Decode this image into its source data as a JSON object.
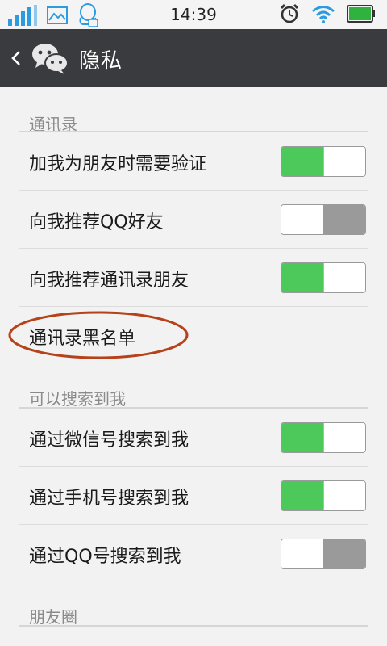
{
  "status_bar": {
    "time": "14:39",
    "icons": [
      "signal-bars-icon",
      "image-icon",
      "qq-icon",
      "alarm-icon",
      "wifi-icon",
      "battery-icon"
    ]
  },
  "header": {
    "title": "隐私",
    "back_icon": "chevron-left-icon",
    "logo": "wechat-logo-icon"
  },
  "sections": [
    {
      "title": "通讯录",
      "items": [
        {
          "label": "加我为朋友时需要验证",
          "toggle": "on"
        },
        {
          "label": "向我推荐QQ好友",
          "toggle": "off"
        },
        {
          "label": "向我推荐通讯录朋友",
          "toggle": "on"
        },
        {
          "label": "通讯录黑名单",
          "toggle": null
        }
      ]
    },
    {
      "title": "可以搜索到我",
      "items": [
        {
          "label": "通过微信号搜索到我",
          "toggle": "on"
        },
        {
          "label": "通过手机号搜索到我",
          "toggle": "on"
        },
        {
          "label": "通过QQ号搜索到我",
          "toggle": "off"
        }
      ]
    },
    {
      "title": "朋友圈",
      "items": []
    }
  ],
  "colors": {
    "header_bg": "#3a3b3e",
    "toggle_on": "#4cc95a",
    "toggle_off": "#9a9a9a",
    "annotation": "#b5421a"
  }
}
